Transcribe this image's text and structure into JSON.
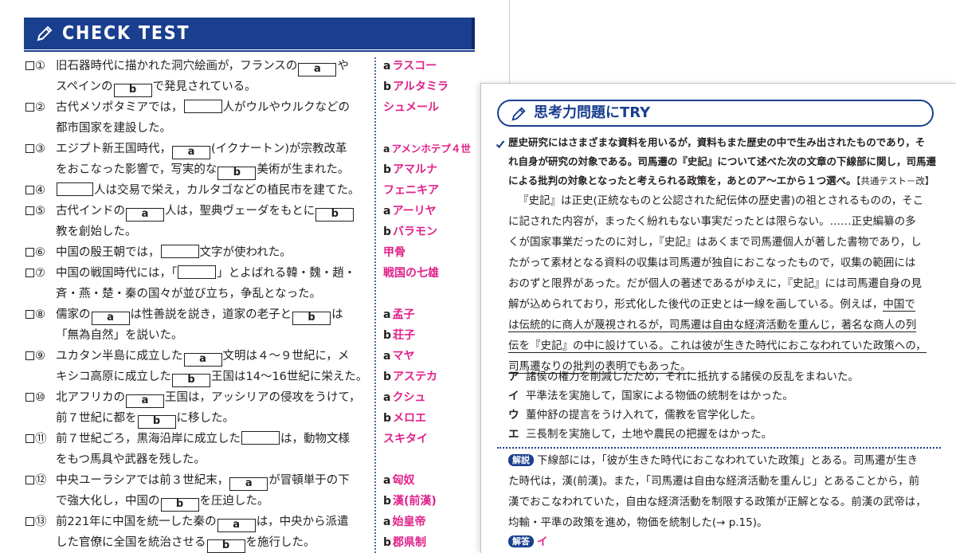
{
  "check_test": {
    "title": "CHECK TEST",
    "questions": [
      {
        "num": "①",
        "l1a": "旧石器時代に描かれた洞穴絵画が，フランスの",
        "b1": "a",
        "l1b": "や",
        "l2a": "スペインの",
        "b2": "b",
        "l2b": "で発見されている。",
        "ans": [
          {
            "letter": "a",
            "text": "ラスコー"
          },
          {
            "letter": "b",
            "text": "アルタミラ"
          }
        ]
      },
      {
        "num": "②",
        "l1a": "古代メソポタミアでは，",
        "b1": "",
        "l1b": "人がウルやウルクなどの",
        "l2a": "都市国家を建設した。",
        "b2": null,
        "l2b": "",
        "ans": [
          {
            "letter": "",
            "text": "シュメール"
          }
        ]
      },
      {
        "num": "③",
        "l1a": "エジプト新王国時代，",
        "b1": "a",
        "l1b": "(イクナートン)が宗教改革",
        "l2a": "をおこなった影響で，写実的な",
        "b2": "b",
        "l2b": "美術が生まれた。",
        "ans": [
          {
            "letter": "a",
            "text": "アメンホテプ４世"
          },
          {
            "letter": "b",
            "text": "アマルナ"
          }
        ]
      },
      {
        "num": "④",
        "l1a": "",
        "b1": "",
        "l1b": "人は交易で栄え，カルタゴなどの植民市を建てた。",
        "l2a": null,
        "b2": null,
        "l2b": null,
        "ans": [
          {
            "letter": "",
            "text": "フェニキア"
          }
        ]
      },
      {
        "num": "⑤",
        "l1a": "古代インドの",
        "b1": "a",
        "l1b": "人は，聖典ヴェーダをもとに",
        "b1x": "b",
        "l2a": "教を創始した。",
        "b2": null,
        "l2b": "",
        "ans": [
          {
            "letter": "a",
            "text": "アーリヤ"
          },
          {
            "letter": "b",
            "text": "バラモン"
          }
        ]
      },
      {
        "num": "⑥",
        "l1a": "中国の殷王朝では，",
        "b1": "",
        "l1b": "文字が使われた。",
        "l2a": null,
        "b2": null,
        "l2b": null,
        "ans": [
          {
            "letter": "",
            "text": "甲骨"
          }
        ]
      },
      {
        "num": "⑦",
        "l1a": "中国の戦国時代には，「",
        "b1": "",
        "l1b": "」とよばれる韓・魏・趙・",
        "l2a": "斉・燕・楚・秦の国々が並び立ち，争乱となった。",
        "b2": null,
        "l2b": "",
        "ans": [
          {
            "letter": "",
            "text": "戦国の七雄"
          }
        ]
      },
      {
        "num": "⑧",
        "l1a": "儒家の",
        "b1": "a",
        "l1b": "は性善説を説き，道家の老子と",
        "b1x": "b",
        "l1c": "は",
        "l2a": "「無為自然」を説いた。",
        "b2": null,
        "l2b": "",
        "ans": [
          {
            "letter": "a",
            "text": "孟子"
          },
          {
            "letter": "b",
            "text": "荘子"
          }
        ]
      },
      {
        "num": "⑨",
        "l1a": "ユカタン半島に成立した",
        "b1": "a",
        "l1b": "文明は４～９世紀に，メ",
        "l2a": "キシコ高原に成立した",
        "b2": "b",
        "l2b": "王国は14～16世紀に栄えた。",
        "ans": [
          {
            "letter": "a",
            "text": "マヤ"
          },
          {
            "letter": "b",
            "text": "アステカ"
          }
        ]
      },
      {
        "num": "⑩",
        "l1a": "北アフリカの",
        "b1": "a",
        "l1b": "王国は，アッシリアの侵攻をうけて，",
        "l2a": "前７世紀に都を",
        "b2": "b",
        "l2b": "に移した。",
        "ans": [
          {
            "letter": "a",
            "text": "クシュ"
          },
          {
            "letter": "b",
            "text": "メロエ"
          }
        ]
      },
      {
        "num": "⑪",
        "l1a": "前７世紀ごろ，黒海沿岸に成立した",
        "b1": "",
        "l1b": "は，動物文様",
        "l2a": "をもつ馬具や武器を残した。",
        "b2": null,
        "l2b": "",
        "ans": [
          {
            "letter": "",
            "text": "スキタイ"
          }
        ]
      },
      {
        "num": "⑫",
        "l1a": "中央ユーラシアでは前３世紀末，",
        "b1": "a",
        "l1b": "が冒頓単于の下",
        "l2a": "で強大化し，中国の",
        "b2": "b",
        "l2b": "を圧迫した。",
        "ans": [
          {
            "letter": "a",
            "text": "匈奴"
          },
          {
            "letter": "b",
            "text": "漢(前漢)"
          }
        ]
      },
      {
        "num": "⑬",
        "l1a": "前221年に中国を統一した秦の",
        "b1": "a",
        "l1b": "は，中央から派遣",
        "l2a": "した官僚に全国を統治させる",
        "b2": "b",
        "l2b": "を施行した。",
        "ans": [
          {
            "letter": "a",
            "text": "始皇帝"
          },
          {
            "letter": "b",
            "text": "郡県制"
          }
        ]
      }
    ]
  },
  "try": {
    "title": "思考力問題にTRY",
    "question": [
      "歴史研究にはさまざまな資料を用いるが，資料もまた歴史の中で生み出されたものであり，そ",
      "れ自身が研究の対象である。司馬遷の『史記』について述べた次の文章の下線部に関し，司馬遷",
      "による批判の対象となったと考えられる政策を，あとのア～エから１つ選べ。"
    ],
    "source": "【共通テスト－改】",
    "passage": [
      "『史記』は正史(正統なものと公認された紀伝体の歴史書)の祖とされるものの，そこ",
      "に記された内容が，まったく紛れもない事実だったとは限らない。……正史編纂の多",
      "くが国家事業だったのに対し，『史記』はあくまで司馬遷個人が著した書物であり，し",
      "たがって素材となる資料の収集は司馬遷が独自におこなったもので，収集の範囲には",
      "おのずと限界があった。だが個人の著述であるがゆえに，『史記』には司馬遷自身の見",
      "解が込められており，形式化した後代の正史とは一線を画している。例えば，",
      "中国で",
      "は伝統的に商人が蔑視されるが，司馬遷は自由な経済活動を重んじ，著名な商人の列",
      "伝を『史記』の中に設けている。これは彼が生きた時代におこなわれていた政策への，",
      "司馬遷なりの批判の表明でもあった。"
    ],
    "choices": [
      {
        "letter": "ア",
        "text": "諸侯の権力を削減したため，それに抵抗する諸侯の反乱をまねいた。"
      },
      {
        "letter": "イ",
        "text": "平準法を実施して，国家による物価の統制をはかった。"
      },
      {
        "letter": "ウ",
        "text": "董仲舒の提言をうけ入れて，儒教を官学化した。"
      },
      {
        "letter": "エ",
        "text": "三長制を実施して，土地や農民の把握をはかった。"
      }
    ],
    "explanation_label": "解説",
    "explanation": [
      "下線部には，「彼が生きた時代におこなわれていた政策」とある。司馬遷が生き",
      "た時代は，漢(前漢)。また，「司馬遷は自由な経済活動を重んじ」とあることから，前",
      "漢でおこなわれていた，自由な経済活動を制限する政策が正解となる。前漢の武帝は，",
      "均輸・平準の政策を進め，物価を統制した(→ p.15)。"
    ],
    "answer_label": "解答",
    "answer": "イ"
  },
  "colors": {
    "navy": "#1a3f8f",
    "magenta": "#e0218a"
  }
}
